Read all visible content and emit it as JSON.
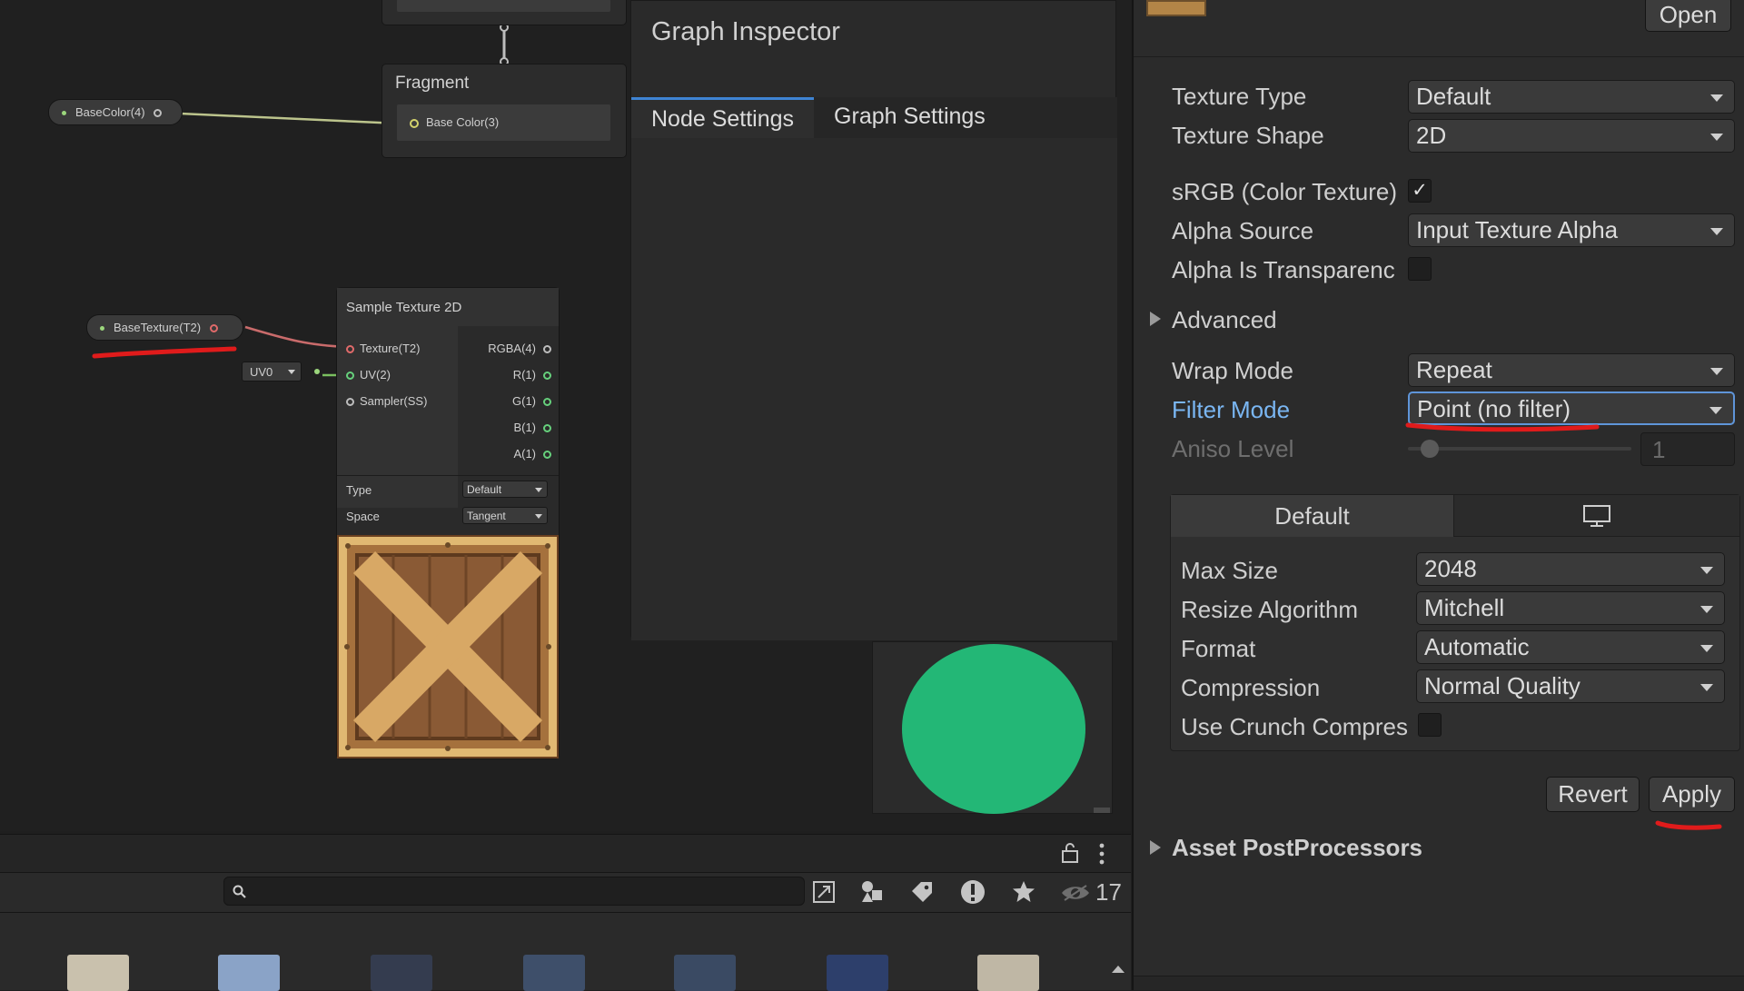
{
  "graph": {
    "fragment_title": "Fragment",
    "fragment_slot": "Base Color(3)",
    "base_color_property": "BaseColor(4)",
    "base_texture_property": "BaseTexture(T2)",
    "uv_dropdown": "UV0",
    "sample_node": {
      "title": "Sample Texture 2D",
      "inputs": [
        "Texture(T2)",
        "UV(2)",
        "Sampler(SS)"
      ],
      "outputs": [
        "RGBA(4)",
        "R(1)",
        "G(1)",
        "B(1)",
        "A(1)"
      ],
      "type_label": "Type",
      "type_value": "Default",
      "space_label": "Space",
      "space_value": "Tangent"
    }
  },
  "graph_inspector": {
    "title": "Graph Inspector",
    "tabs": [
      "Node Settings",
      "Graph Settings"
    ],
    "active_tab": "Node Settings"
  },
  "preview": {
    "color": "#23b776"
  },
  "bottom": {
    "search_placeholder": "",
    "asset_count": "17"
  },
  "import_settings": {
    "open_button": "Open",
    "texture_type": {
      "label": "Texture Type",
      "value": "Default"
    },
    "texture_shape": {
      "label": "Texture Shape",
      "value": "2D"
    },
    "srgb": {
      "label": "sRGB (Color Texture)",
      "checked": true
    },
    "alpha_source": {
      "label": "Alpha Source",
      "value": "Input Texture Alpha"
    },
    "alpha_transparency": {
      "label": "Alpha Is Transparenc",
      "checked": false
    },
    "advanced": "Advanced",
    "wrap_mode": {
      "label": "Wrap Mode",
      "value": "Repeat"
    },
    "filter_mode": {
      "label": "Filter Mode",
      "value": "Point (no filter)"
    },
    "aniso_level": {
      "label": "Aniso Level",
      "value": "1"
    },
    "platform_tabs": {
      "default_label": "Default",
      "standalone_icon": "monitor-icon"
    },
    "max_size": {
      "label": "Max Size",
      "value": "2048"
    },
    "resize_algorithm": {
      "label": "Resize Algorithm",
      "value": "Mitchell"
    },
    "format": {
      "label": "Format",
      "value": "Automatic"
    },
    "compression": {
      "label": "Compression",
      "value": "Normal Quality"
    },
    "crunch": {
      "label": "Use Crunch Compres",
      "checked": false
    },
    "revert_button": "Revert",
    "apply_button": "Apply",
    "asset_postprocessors": "Asset PostProcessors"
  },
  "colors": {
    "accent_blue": "#3e84d4",
    "highlight_label": "#7ab6f2",
    "annotation_red": "#e01b1b"
  }
}
